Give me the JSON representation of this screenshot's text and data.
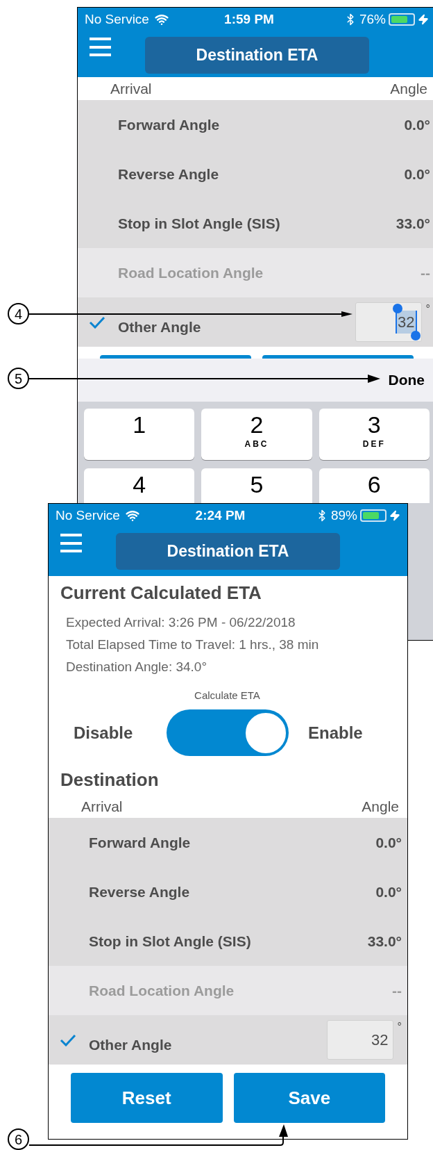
{
  "screens": [
    {
      "status_bar": {
        "carrier": "No Service",
        "time": "1:59 PM",
        "battery": "76%"
      },
      "nav": {
        "title": "Destination ETA"
      },
      "table": {
        "columns": [
          "Arrival",
          "Angle"
        ],
        "rows": [
          {
            "kind": "value",
            "label": "Forward Angle",
            "value": "0.0°",
            "disabled": false,
            "checked": false
          },
          {
            "kind": "value",
            "label": "Reverse Angle",
            "value": "0.0°",
            "disabled": false,
            "checked": false
          },
          {
            "kind": "value",
            "label": "Stop in Slot Angle (SIS)",
            "value": "33.0°",
            "disabled": false,
            "checked": false
          },
          {
            "kind": "value",
            "label": "Road Location Angle",
            "value": "--",
            "disabled": true,
            "checked": false
          },
          {
            "kind": "input",
            "label": "Other Angle",
            "value": "32",
            "unit": "°",
            "text_selected": true,
            "disabled": false,
            "checked": true
          }
        ]
      },
      "keyboard": {
        "done": "Done",
        "keys": [
          {
            "digit": "1"
          },
          {
            "digit": "2",
            "letters": "ABC"
          },
          {
            "digit": "3",
            "letters": "DEF"
          },
          {
            "digit": "4"
          },
          {
            "digit": "5"
          },
          {
            "digit": "6"
          }
        ]
      }
    },
    {
      "status_bar": {
        "carrier": "No Service",
        "time": "2:24 PM",
        "battery": "89%"
      },
      "nav": {
        "title": "Destination ETA"
      },
      "eta": {
        "heading": "Current Calculated ETA",
        "lines": [
          "Expected Arrival: 3:26 PM - 06/22/2018",
          "Total Elapsed Time to Travel: 1 hrs., 38 min",
          "Destination Angle: 34.0°"
        ],
        "toggle": {
          "title": "Calculate ETA",
          "off_label": "Disable",
          "on_label": "Enable",
          "on": true
        }
      },
      "destination_heading": "Destination",
      "table": {
        "columns": [
          "Arrival",
          "Angle"
        ],
        "rows": [
          {
            "kind": "value",
            "label": "Forward Angle",
            "value": "0.0°",
            "disabled": false,
            "checked": false
          },
          {
            "kind": "value",
            "label": "Reverse Angle",
            "value": "0.0°",
            "disabled": false,
            "checked": false
          },
          {
            "kind": "value",
            "label": "Stop in Slot Angle (SIS)",
            "value": "33.0°",
            "disabled": false,
            "checked": false
          },
          {
            "kind": "value",
            "label": "Road Location Angle",
            "value": "--",
            "disabled": true,
            "checked": false
          },
          {
            "kind": "input",
            "label": "Other Angle",
            "value": "32",
            "unit": "°",
            "text_selected": false,
            "disabled": false,
            "checked": true
          }
        ]
      },
      "buttons": [
        "Reset",
        "Save"
      ]
    }
  ],
  "callouts": [
    {
      "label": "4"
    },
    {
      "label": "5"
    },
    {
      "label": "6"
    }
  ]
}
